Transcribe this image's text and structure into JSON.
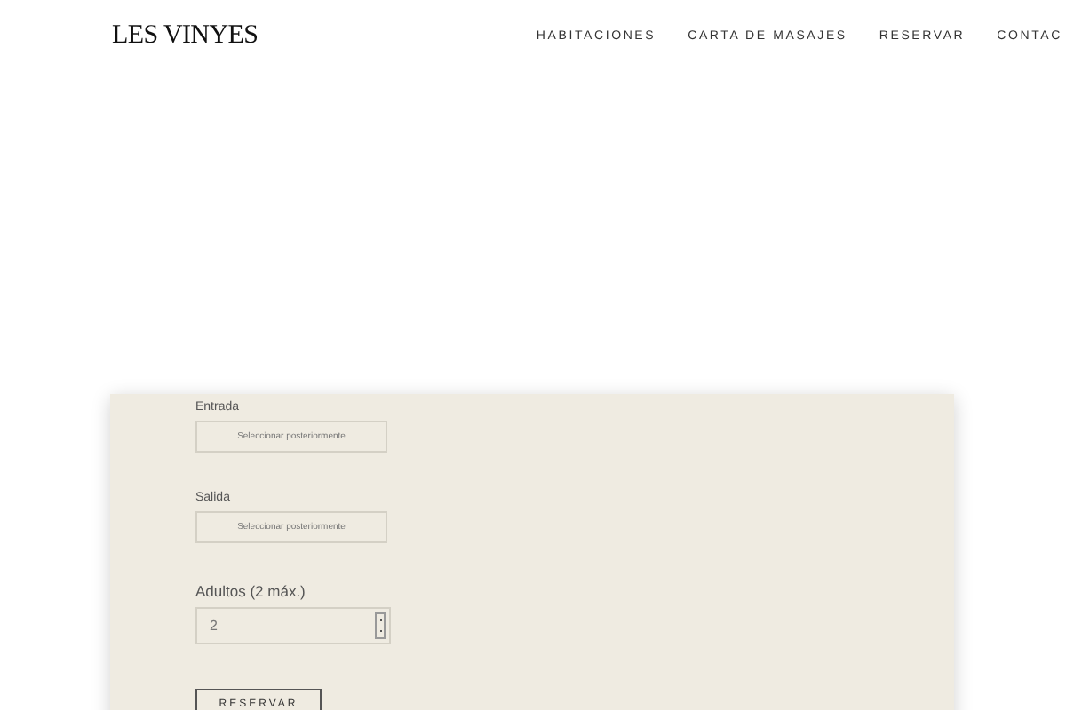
{
  "header": {
    "logo": "LES VINYES",
    "nav": [
      {
        "label": "HABITACIONES"
      },
      {
        "label": "CARTA DE MASAJES"
      },
      {
        "label": "RESERVAR"
      },
      {
        "label": "CONTAC"
      }
    ]
  },
  "form": {
    "fields": [
      {
        "kind": "date",
        "label": "Entrada",
        "placeholder": "Seleccionar posteriormente"
      },
      {
        "kind": "date",
        "label": "Salida",
        "placeholder": "Seleccionar posteriormente"
      },
      {
        "kind": "number",
        "label": "Adultos (2 máx.)",
        "value": "2"
      }
    ],
    "submit": "RESERVAR"
  }
}
